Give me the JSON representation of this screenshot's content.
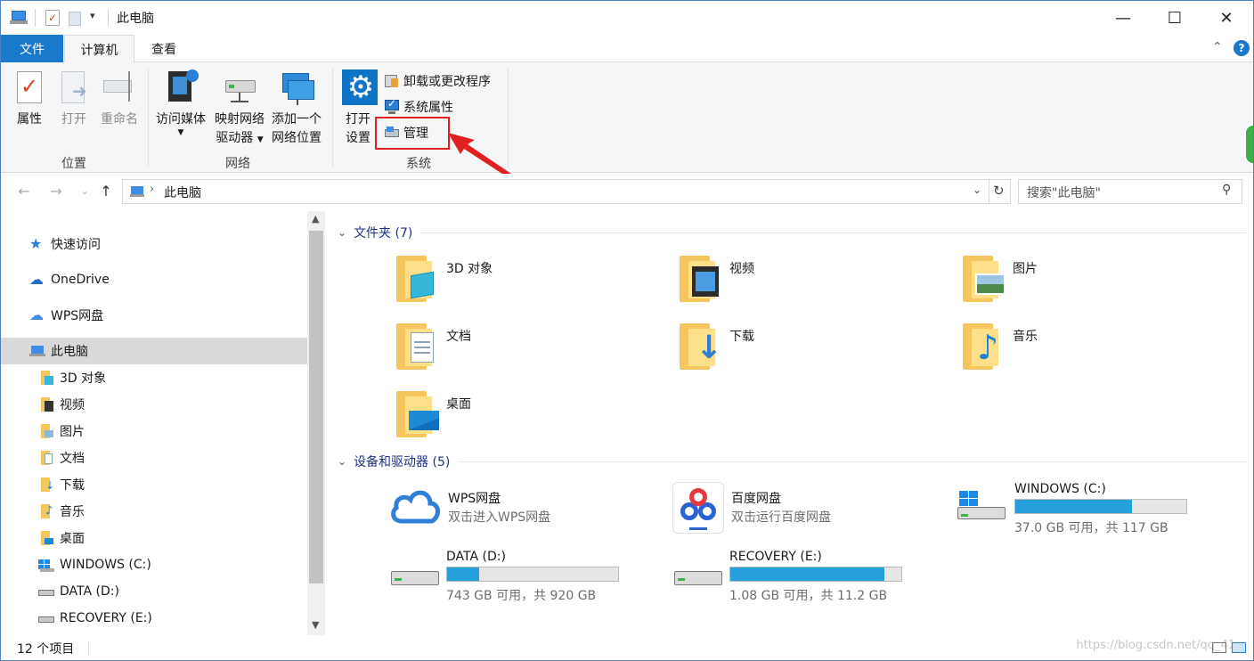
{
  "window": {
    "title": "此电脑"
  },
  "titlebar": {
    "minimize": "—",
    "maximize": "☐",
    "close": "✕"
  },
  "tabs": {
    "file": "文件",
    "computer": "计算机",
    "view": "查看"
  },
  "ribbon": {
    "location": {
      "label": "位置",
      "properties": "属性",
      "open": "打开",
      "rename": "重命名"
    },
    "network": {
      "label": "网络",
      "access_media": "访问媒体",
      "map_drive_line1": "映射网络",
      "map_drive_line2": "驱动器",
      "add_location_line1": "添加一个",
      "add_location_line2": "网络位置"
    },
    "system": {
      "label": "系统",
      "open_settings_line1": "打开",
      "open_settings_line2": "设置",
      "uninstall": "卸载或更改程序",
      "system_properties": "系统属性",
      "manage": "管理"
    }
  },
  "address": {
    "path": "此电脑",
    "search_placeholder": "搜索\"此电脑\""
  },
  "nav": {
    "items": [
      {
        "label": "快速访问"
      },
      {
        "label": "OneDrive"
      },
      {
        "label": "WPS网盘"
      },
      {
        "label": "此电脑"
      },
      {
        "label": "3D 对象"
      },
      {
        "label": "视频"
      },
      {
        "label": "图片"
      },
      {
        "label": "文档"
      },
      {
        "label": "下载"
      },
      {
        "label": "音乐"
      },
      {
        "label": "桌面"
      },
      {
        "label": "WINDOWS (C:)"
      },
      {
        "label": "DATA (D:)"
      },
      {
        "label": "RECOVERY (E:)"
      }
    ]
  },
  "content": {
    "folders_header": "文件夹 (7)",
    "folders": [
      {
        "name": "3D 对象"
      },
      {
        "name": "视频"
      },
      {
        "name": "图片"
      },
      {
        "name": "文档"
      },
      {
        "name": "下载"
      },
      {
        "name": "音乐"
      },
      {
        "name": "桌面"
      }
    ],
    "devices_header": "设备和驱动器 (5)",
    "cloud": [
      {
        "name": "WPS网盘",
        "subtitle": "双击进入WPS网盘"
      },
      {
        "name": "百度网盘",
        "subtitle": "双击运行百度网盘"
      }
    ],
    "drives": [
      {
        "name": "WINDOWS (C:)",
        "free_text": "37.0 GB 可用，共 117 GB",
        "used_fraction": 0.68
      },
      {
        "name": "DATA (D:)",
        "free_text": "743 GB 可用，共 920 GB",
        "used_fraction": 0.19
      },
      {
        "name": "RECOVERY (E:)",
        "free_text": "1.08 GB 可用，共 11.2 GB",
        "used_fraction": 0.9
      }
    ]
  },
  "status": {
    "count": "12 个项目",
    "watermark": "https://blog.csdn.net/qq_41"
  },
  "colors": {
    "accent": "#1979ca",
    "drive_fill": "#26a0da",
    "highlight": "#e02020",
    "folder": "#f5c65d"
  }
}
